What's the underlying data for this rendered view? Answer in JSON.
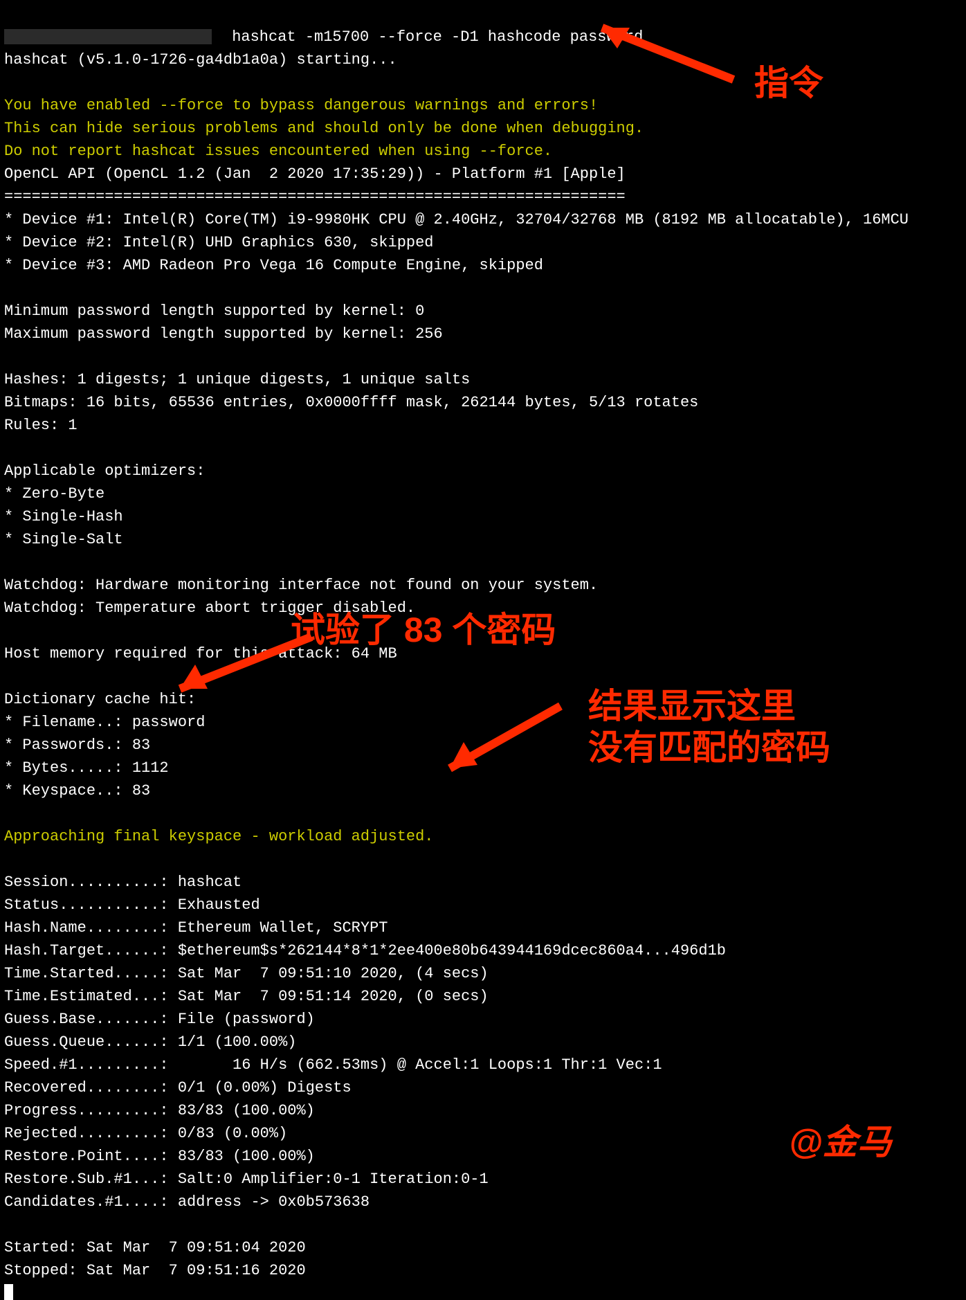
{
  "cmd_line": " hashcat -m15700 --force -D1 hashcode password",
  "starting": "hashcat (v5.1.0-1726-ga4db1a0a) starting...",
  "warn1": "You have enabled --force to bypass dangerous warnings and errors!",
  "warn2": "This can hide serious problems and should only be done when debugging.",
  "warn3": "Do not report hashcat issues encountered when using --force.",
  "opencl": "OpenCL API (OpenCL 1.2 (Jan  2 2020 17:35:29)) - Platform #1 [Apple]",
  "divider": "====================================================================",
  "dev1": "* Device #1: Intel(R) Core(TM) i9-9980HK CPU @ 2.40GHz, 32704/32768 MB (8192 MB allocatable), 16MCU",
  "dev2": "* Device #2: Intel(R) UHD Graphics 630, skipped",
  "dev3": "* Device #3: AMD Radeon Pro Vega 16 Compute Engine, skipped",
  "minpw": "Minimum password length supported by kernel: 0",
  "maxpw": "Maximum password length supported by kernel: 256",
  "hashes": "Hashes: 1 digests; 1 unique digests, 1 unique salts",
  "bitmaps": "Bitmaps: 16 bits, 65536 entries, 0x0000ffff mask, 262144 bytes, 5/13 rotates",
  "rules": "Rules: 1",
  "optim_hdr": "Applicable optimizers:",
  "optim1": "* Zero-Byte",
  "optim2": "* Single-Hash",
  "optim3": "* Single-Salt",
  "wd1": "Watchdog: Hardware monitoring interface not found on your system.",
  "wd2": "Watchdog: Temperature abort trigger disabled.",
  "hostmem": "Host memory required for this attack: 64 MB",
  "dcache": "Dictionary cache hit:",
  "dc_file": "* Filename..: password",
  "dc_pw": "* Passwords.: 83",
  "dc_by": "* Bytes.....: 1112",
  "dc_ks": "* Keyspace..: 83",
  "approach": "Approaching final keyspace - workload adjusted.",
  "s_session": "Session..........: hashcat",
  "s_status": "Status...........: Exhausted",
  "s_hn": "Hash.Name........: Ethereum Wallet, SCRYPT",
  "s_ht": "Hash.Target......: $ethereum$s*262144*8*1*2ee400e80b643944169dcec860a4...496d1b",
  "s_ts": "Time.Started.....: Sat Mar  7 09:51:10 2020, (4 secs)",
  "s_te": "Time.Estimated...: Sat Mar  7 09:51:14 2020, (0 secs)",
  "s_gb": "Guess.Base.......: File (password)",
  "s_gq": "Guess.Queue......: 1/1 (100.00%)",
  "s_sp": "Speed.#1.........:       16 H/s (662.53ms) @ Accel:1 Loops:1 Thr:1 Vec:1",
  "s_rec": "Recovered........: 0/1 (0.00%) Digests",
  "s_prog": "Progress.........: 83/83 (100.00%)",
  "s_rej": "Rejected.........: 0/83 (0.00%)",
  "s_rp": "Restore.Point....: 83/83 (100.00%)",
  "s_rs": "Restore.Sub.#1...: Salt:0 Amplifier:0-1 Iteration:0-1",
  "s_cand": "Candidates.#1....: address -> 0x0b573638",
  "started": "Started: Sat Mar  7 09:51:04 2020",
  "stopped": "Stopped: Sat Mar  7 09:51:16 2020",
  "annot": {
    "cmd": "指令",
    "tried": "试验了 83 个密码",
    "result": "结果显示这里\n没有匹配的密码",
    "sign": "@金马"
  }
}
